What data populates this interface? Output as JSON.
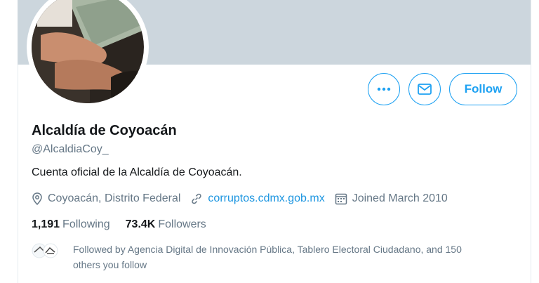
{
  "profile": {
    "name": "Alcaldía de Coyoacán",
    "handle": "@AlcaldiaCoy_",
    "bio": "Cuenta oficial de la Alcaldía de Coyoacán.",
    "location": "Coyoacán, Distrito Federal",
    "website": "corruptos.cdmx.gob.mx",
    "joined": "Joined March 2010"
  },
  "stats": {
    "following_count": "1,191",
    "following_label": "Following",
    "followers_count": "73.4K",
    "followers_label": "Followers"
  },
  "actions": {
    "follow_label": "Follow",
    "more_icon": "more-icon",
    "message_icon": "envelope-icon"
  },
  "followed_by": {
    "text_line1": "Followed by Agencia Digital de Innovación Pública, Tablero Electoral Ciudadano, and 150",
    "text_line2": "others you follow"
  },
  "colors": {
    "accent": "#1da1f2",
    "link": "#1b95e0",
    "banner": "#ccd6dd",
    "secondary_text": "#657786"
  }
}
